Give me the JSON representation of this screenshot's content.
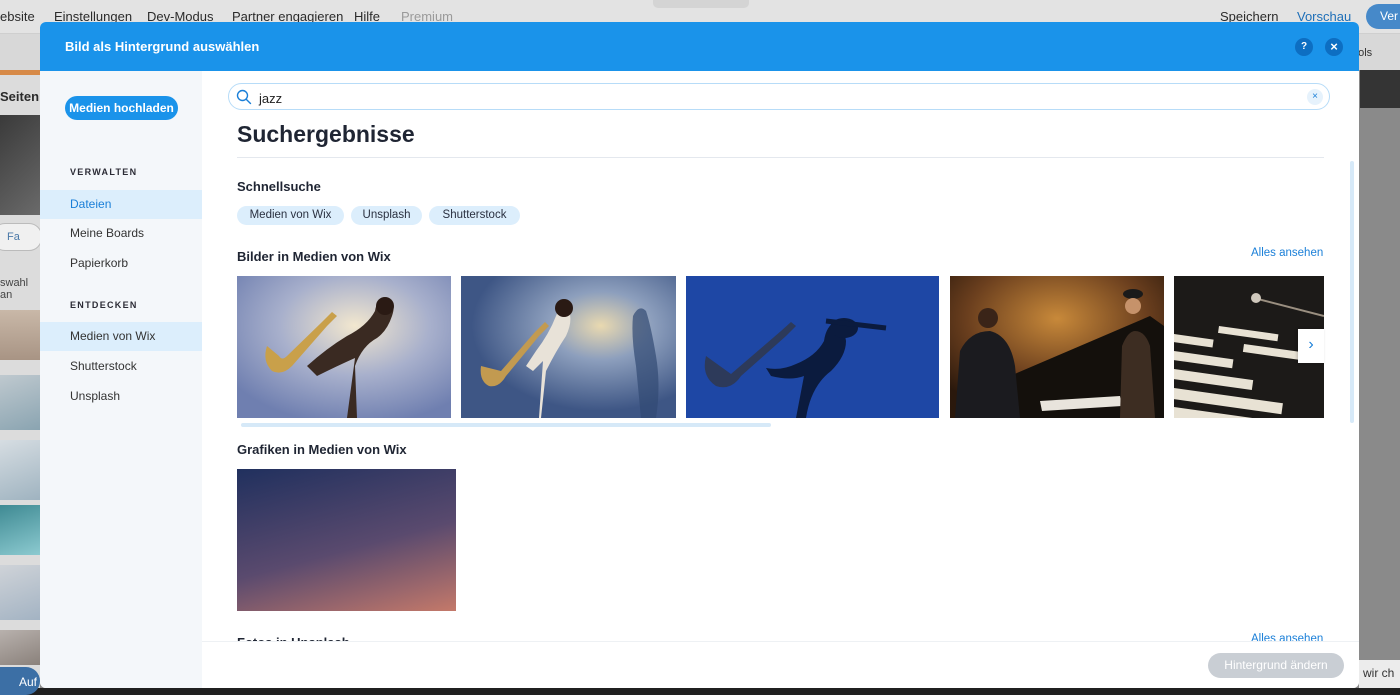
{
  "editor": {
    "menu": [
      "ebsite",
      "Einstellungen",
      "Dev-Modus",
      "Partner engagieren",
      "Hilfe",
      "Premium"
    ],
    "save_label": "Speichern",
    "preview_label": "Vorschau",
    "publish_label": "Ver",
    "tools_label": "ools",
    "left_title": "Seiten",
    "left_pill_label": "Fa",
    "left_text": "swahl an",
    "bottom_button_label": "Auf",
    "chat_snippet": "wir ch"
  },
  "modal": {
    "title": "Bild als Hintergrund auswählen",
    "help_icon": "?",
    "close_icon": "×"
  },
  "sidebar": {
    "upload_label": "Medien hochladen",
    "manage_heading": "VERWALTEN",
    "manage_items": [
      "Dateien",
      "Meine Boards",
      "Papierkorb"
    ],
    "discover_heading": "ENTDECKEN",
    "discover_items": [
      "Medien von Wix",
      "Shutterstock",
      "Unsplash"
    ]
  },
  "search": {
    "value": "jazz",
    "clear_icon": "×"
  },
  "results": {
    "title": "Suchergebnisse",
    "quick_search_heading": "Schnellsuche",
    "quick_chips": [
      "Medien von Wix",
      "Unsplash",
      "Shutterstock"
    ],
    "images_heading": "Bilder in Medien von Wix",
    "see_all": "Alles ansehen",
    "images": [
      "saxophonist-light-backdrop",
      "saxophonist-spotlight",
      "saxophonist-silhouette-blue",
      "jazz-pianist-band",
      "vibraphone-closeup"
    ],
    "graphics_heading": "Grafiken in Medien von Wix",
    "unsplash_heading": "Fotos in Unsplash",
    "see_all_2": "Alles ansehen"
  },
  "footer": {
    "change_label": "Hintergrund ändern"
  },
  "colors": {
    "accent": "#1a93ea",
    "sidebar_bg": "#f4f7fa",
    "chip_bg": "#dceefc",
    "disabled_button": "#c9ced4"
  }
}
